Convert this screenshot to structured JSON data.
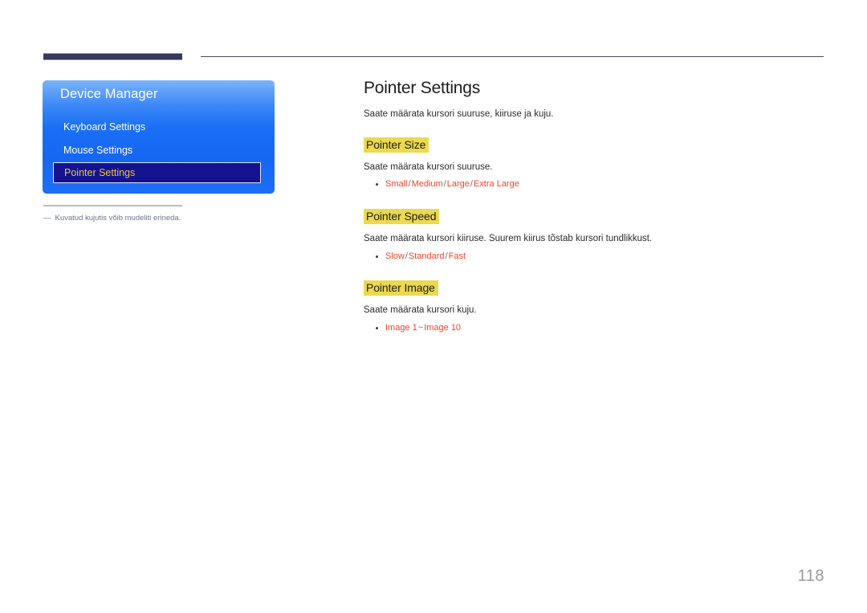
{
  "header": {
    "bar_color": "#353a5c",
    "rule_color": "#4a4a63"
  },
  "osd": {
    "title": "Device Manager",
    "accent_selected_text": "#f0c23c",
    "items": [
      {
        "label": "Keyboard Settings",
        "selected": false
      },
      {
        "label": "Mouse Settings",
        "selected": false
      },
      {
        "label": "Pointer Settings",
        "selected": true
      }
    ]
  },
  "footnote": {
    "dash": "―",
    "text": "Kuvatud kujutis võib mudeliti erineda."
  },
  "content": {
    "title": "Pointer Settings",
    "lead": "Saate määrata kursori suuruse, kiiruse ja kuju.",
    "highlight_color": "#ecd94f",
    "option_color": "#e8452c",
    "sections": [
      {
        "heading": "Pointer Size",
        "description": "Saate määrata kursori suuruse.",
        "options": [
          "Small",
          "Medium",
          "Large",
          "Extra Large"
        ],
        "separator": "/"
      },
      {
        "heading": "Pointer Speed",
        "description": "Saate määrata kursori kiiruse. Suurem kiirus tõstab kursori tundlikkust.",
        "options": [
          "Slow",
          "Standard",
          "Fast"
        ],
        "separator": "/"
      },
      {
        "heading": "Pointer Image",
        "description": "Saate määrata kursori kuju.",
        "options": [
          "Image 1",
          "Image 10"
        ],
        "separator": "~"
      }
    ]
  },
  "page_number": "118"
}
